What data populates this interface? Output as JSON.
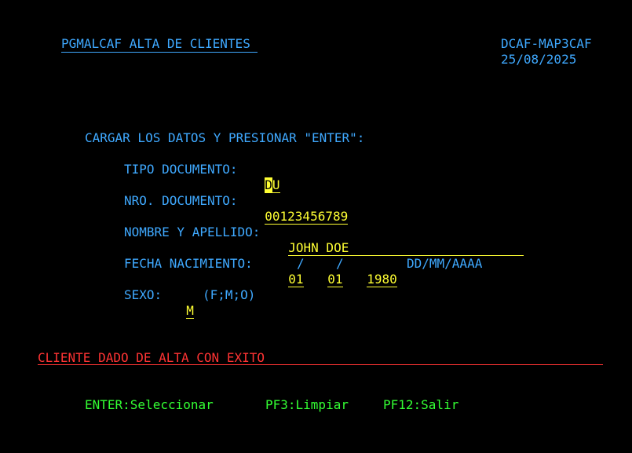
{
  "header": {
    "program_title": "PGMALCAF ALTA DE CLIENTES ",
    "mapset": "DCAF-MAP3CAF",
    "date": "25/08/2025"
  },
  "form": {
    "instruction": "CARGAR LOS DATOS Y PRESIONAR \"ENTER\":",
    "tipo_documento": {
      "label": "TIPO DOCUMENTO: ",
      "value_cursor": "D",
      "value_rest": "U"
    },
    "nro_documento": {
      "label": "NRO. DOCUMENTO: ",
      "value": "00123456789"
    },
    "nombre_apellido": {
      "label": "NOMBRE Y APELLIDO: ",
      "value": "JOHN DOE"
    },
    "fecha_nacimiento": {
      "label": "FECHA NACIMIENTO: ",
      "day": "01",
      "month": "01",
      "year": "1980",
      "separator": "/",
      "format_hint": "DD/MM/AAAA"
    },
    "sexo": {
      "label": "SEXO: ",
      "value": "M",
      "options_hint": "(F;M;O)"
    }
  },
  "message": {
    "text": "CLIENTE DADO DE ALTA CON EXITO"
  },
  "function_keys": {
    "enter": "ENTER:Seleccionar",
    "pf3": "PF3:Limpiar",
    "pf12": "PF12:Salir"
  },
  "colors": {
    "background": "#000000",
    "label_blue": "#3fa9ff",
    "field_yellow": "#ffff33",
    "message_red": "#ff3333",
    "keys_green": "#33ff33"
  }
}
